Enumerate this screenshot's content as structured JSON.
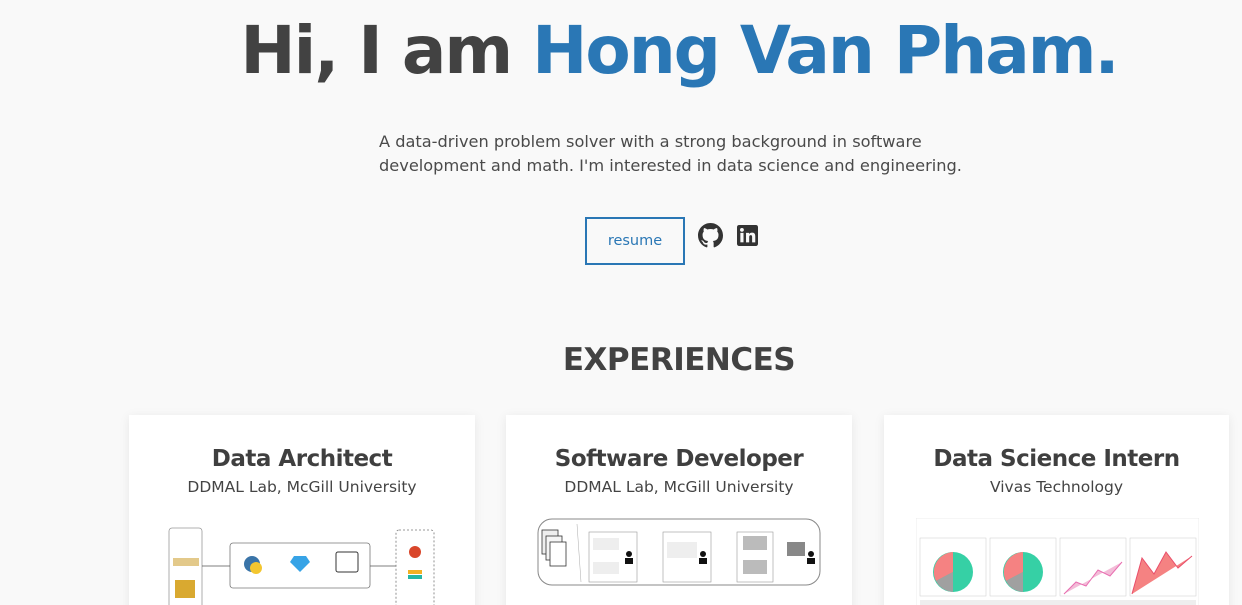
{
  "hero": {
    "greeting": "Hi, I am ",
    "name": "Hong Van Pham."
  },
  "intro": {
    "line1": "A data-driven problem solver with a strong background in software",
    "line2": "development and math. I'm interested in data science and engineering."
  },
  "links": {
    "resume_label": "resume",
    "github_icon": "github-icon",
    "linkedin_icon": "linkedin-icon"
  },
  "experiences": {
    "section_title": "EXPERIENCES",
    "items": [
      {
        "title": "Data Architect",
        "org": "DDMAL Lab, McGill University"
      },
      {
        "title": "Software Developer",
        "org": "DDMAL Lab, McGill University"
      },
      {
        "title": "Data Science Intern",
        "org": "Vivas Technology"
      }
    ]
  },
  "colors": {
    "accent": "#2a77b5",
    "heading": "#424242",
    "background": "#f9f9f9"
  }
}
